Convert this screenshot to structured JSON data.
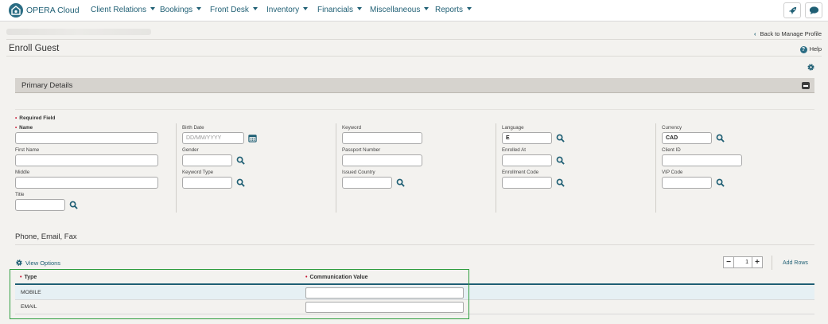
{
  "app": {
    "name": "OPERA Cloud",
    "nav": [
      "Client Relations",
      "Bookings",
      "Front Desk",
      "Inventory",
      "Financials",
      "Miscellaneous",
      "Reports"
    ]
  },
  "header": {
    "back_link": "Back to Manage Profile",
    "page_title": "Enroll Guest",
    "help": "Help"
  },
  "primary_details": {
    "title": "Primary Details",
    "required_legend": "Required Field",
    "columns": {
      "col1": {
        "name_label": "Name",
        "first_name_label": "First Name",
        "middle_label": "Middle",
        "title_label": "Title"
      },
      "col2": {
        "birth_date_label": "Birth Date",
        "birth_date_placeholder": "DD/MM/YYYY",
        "gender_label": "Gender",
        "keyword_type_label": "Keyword Type"
      },
      "col3": {
        "keyword_label": "Keyword",
        "passport_label": "Passport Number",
        "issued_country_label": "Issued Country"
      },
      "col4": {
        "language_label": "Language",
        "language_value": "E",
        "enrolled_at_label": "Enrolled At",
        "enrollment_code_label": "Enrollment Code"
      },
      "col5": {
        "currency_label": "Currency",
        "currency_value": "CAD",
        "client_id_label": "Client ID",
        "vip_code_label": "VIP Code"
      }
    }
  },
  "communication": {
    "title": "Phone, Email, Fax",
    "view_options": "View Options",
    "rows_count": "1",
    "add_rows": "Add Rows",
    "columns": [
      "Type",
      "Communication Value"
    ],
    "rows": [
      {
        "type": "MOBILE",
        "value": ""
      },
      {
        "type": "EMAIL",
        "value": ""
      }
    ]
  },
  "colors": {
    "brand": "#1f5f74",
    "required": "#c8102e",
    "highlight": "#2f9e3f"
  }
}
